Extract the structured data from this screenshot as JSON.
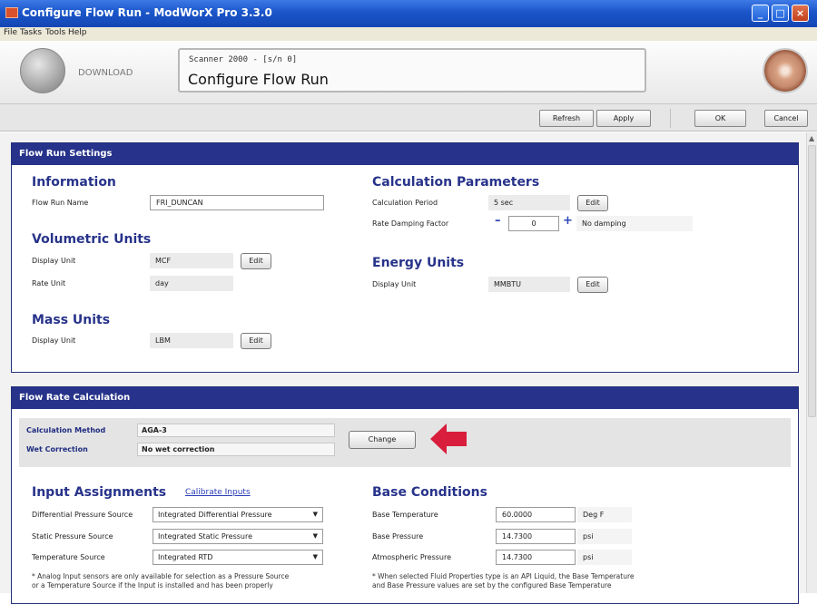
{
  "window": {
    "title": "Configure Flow Run - ModWorX Pro 3.3.0",
    "controls": [
      "minimize",
      "maximize",
      "close"
    ]
  },
  "menu": [
    "File",
    "Tasks",
    "Tools",
    "Help"
  ],
  "header": {
    "download_label": "DOWNLOAD",
    "device": "Scanner 2000 -  [s/n 0]",
    "page_title": "Configure Flow Run"
  },
  "toolbar": {
    "refresh": "Refresh",
    "apply": "Apply",
    "ok": "OK",
    "cancel": "Cancel"
  },
  "flow_run_settings": {
    "header": "Flow Run Settings",
    "information": {
      "title": "Information",
      "flow_run_name_label": "Flow Run Name",
      "flow_run_name_value": "FRI_DUNCAN"
    },
    "volumetric_units": {
      "title": "Volumetric Units",
      "display_unit_label": "Display Unit",
      "display_unit_value": "MCF",
      "rate_unit_label": "Rate Unit",
      "rate_unit_value": "day",
      "edit": "Edit"
    },
    "mass_units": {
      "title": "Mass Units",
      "display_unit_label": "Display Unit",
      "display_unit_value": "LBM",
      "edit": "Edit"
    },
    "calculation_parameters": {
      "title": "Calculation Parameters",
      "period_label": "Calculation Period",
      "period_value": "5 sec",
      "edit": "Edit",
      "damping_label": "Rate Damping Factor",
      "damping_value": "0",
      "minus": "–",
      "plus": "+",
      "damping_note": "No damping"
    },
    "energy_units": {
      "title": "Energy Units",
      "display_unit_label": "Display Unit",
      "display_unit_value": "MMBTU",
      "edit": "Edit"
    }
  },
  "flow_rate_calculation": {
    "header": "Flow Rate Calculation",
    "method_label": "Calculation Method",
    "method_value": "AGA-3",
    "wet_label": "Wet Correction",
    "wet_value": "No wet correction",
    "change": "Change",
    "input_assignments": {
      "title": "Input Assignments",
      "calibrate_link": "Calibrate Inputs",
      "rows": [
        {
          "label": "Differential Pressure Source",
          "value": "Integrated Differential Pressure"
        },
        {
          "label": "Static Pressure Source",
          "value": "Integrated Static Pressure"
        },
        {
          "label": "Temperature Source",
          "value": "Integrated RTD"
        }
      ],
      "note1": "* Analog Input sensors are only available for selection as a Pressure Source",
      "note2": "or a Temperature Source if the Input is installed and has been properly"
    },
    "base_conditions": {
      "title": "Base Conditions",
      "rows": [
        {
          "label": "Base Temperature",
          "value": "60.0000",
          "unit": "Deg F"
        },
        {
          "label": "Base Pressure",
          "value": "14.7300",
          "unit": "psi"
        },
        {
          "label": "Atmospheric Pressure",
          "value": "14.7300",
          "unit": "psi"
        }
      ],
      "note1": "* When selected Fluid Properties type is an API Liquid, the Base Temperature",
      "note2": "and Base Pressure values are set by the configured Base Temperature"
    }
  },
  "colors": {
    "panel_header": "#27338a",
    "section_title": "#27338a",
    "callout_arrow": "#d81e3c",
    "titlebar": "#1a55c9"
  }
}
